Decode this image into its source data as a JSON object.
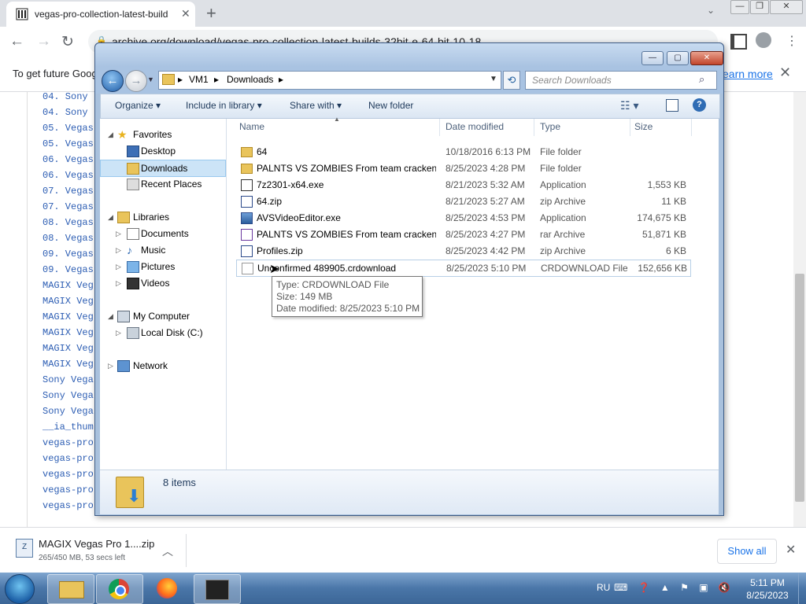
{
  "browser": {
    "tab_title": "vegas-pro-collection-latest-builds",
    "url": "archive.org/download/vegas-pro-collection-latest-builds-32bit-e-64-bit-10-18",
    "infobar_text": "To get future Goog",
    "learn_more": "earn more",
    "page_links": [
      "04. Sony",
      "04. Sony",
      "05. Vegas",
      "05. Vegas",
      "06. Vegas",
      "06. Vegas",
      "07. Vegas",
      "07. Vegas",
      "08. Vegas",
      "08. Vegas",
      "09. Vegas",
      "09. Vegas",
      "MAGIX Veg",
      "MAGIX Veg",
      "MAGIX Veg",
      "MAGIX Veg",
      "MAGIX Veg",
      "MAGIX Veg",
      "Sony Vega",
      "Sony Vega",
      "Sony Vega",
      "__ia_thum",
      "vegas-pro",
      "vegas-pro",
      "vegas-pro",
      "vegas-pro",
      "vegas-pro"
    ],
    "download": {
      "name": "MAGIX Vegas Pro 1....zip",
      "progress_text": "265/450 MB, 53 secs left",
      "show_all": "Show all"
    }
  },
  "explorer": {
    "breadcrumb": [
      "VM1",
      "Downloads"
    ],
    "search_placeholder": "Search Downloads",
    "commands": [
      "Organize",
      "Include in library",
      "Share with",
      "New folder"
    ],
    "nav": {
      "favorites": "Favorites",
      "desktop": "Desktop",
      "downloads": "Downloads",
      "recent": "Recent Places",
      "libraries": "Libraries",
      "documents": "Documents",
      "music": "Music",
      "pictures": "Pictures",
      "videos": "Videos",
      "computer": "My Computer",
      "local_disk": "Local Disk (C:)",
      "network": "Network"
    },
    "columns": {
      "name": "Name",
      "date": "Date modified",
      "type": "Type",
      "size": "Size"
    },
    "files": [
      {
        "name": "64",
        "date": "10/18/2016 6:13 PM",
        "type": "File folder",
        "size": "",
        "icon": "folder-icon"
      },
      {
        "name": "PALNTS VS ZOMBIES From team cracken",
        "date": "8/25/2023 4:28 PM",
        "type": "File folder",
        "size": "",
        "icon": "folder-icon"
      },
      {
        "name": "7z2301-x64.exe",
        "date": "8/21/2023 5:32 AM",
        "type": "Application",
        "size": "1,553 KB",
        "icon": "exe-icon"
      },
      {
        "name": "64.zip",
        "date": "8/21/2023 5:27 AM",
        "type": "zip Archive",
        "size": "11 KB",
        "icon": "zip-icon"
      },
      {
        "name": "AVSVideoEditor.exe",
        "date": "8/25/2023 4:53 PM",
        "type": "Application",
        "size": "174,675 KB",
        "icon": "app-icon"
      },
      {
        "name": "PALNTS VS ZOMBIES From team cracken...",
        "date": "8/25/2023 4:27 PM",
        "type": "rar Archive",
        "size": "51,871 KB",
        "icon": "rar-icon"
      },
      {
        "name": "Profiles.zip",
        "date": "8/25/2023 4:42 PM",
        "type": "zip Archive",
        "size": "6 KB",
        "icon": "zip-icon"
      },
      {
        "name": "Unconfirmed 489905.crdownload",
        "date": "8/25/2023 5:10 PM",
        "type": "CRDOWNLOAD File",
        "size": "152,656 KB",
        "icon": "file-icon"
      }
    ],
    "tooltip": {
      "type": "Type: CRDOWNLOAD File",
      "size": "Size: 149 MB",
      "date": "Date modified: 8/25/2023 5:10 PM"
    },
    "items_count": "8 items"
  },
  "taskbar": {
    "lang": "RU",
    "time": "5:11 PM",
    "date": "8/25/2023"
  }
}
